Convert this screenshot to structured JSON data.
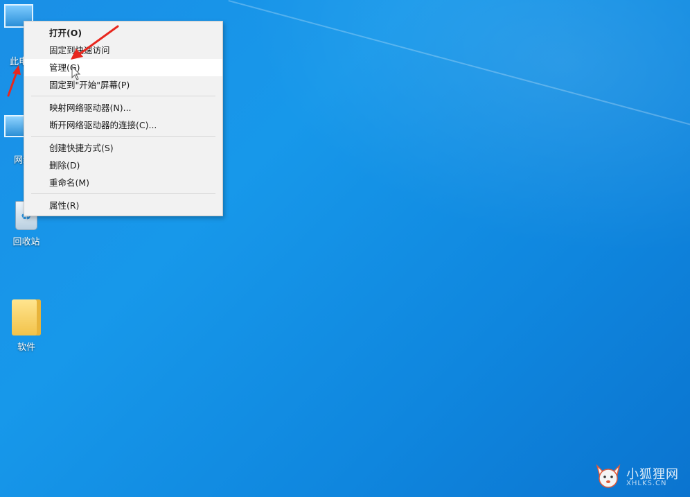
{
  "desktop": {
    "icons": [
      {
        "label": "此电脑"
      },
      {
        "label": "网络"
      },
      {
        "label": "回收站"
      },
      {
        "label": "软件"
      }
    ]
  },
  "context_menu": {
    "items": [
      {
        "label": "打开(O)",
        "bold": true
      },
      {
        "label": "固定到快速访问"
      },
      {
        "label": "管理(G)",
        "highlighted": true
      },
      {
        "label": "固定到\"开始\"屏幕(P)"
      },
      {
        "label": "映射网络驱动器(N)..."
      },
      {
        "label": "断开网络驱动器的连接(C)..."
      },
      {
        "label": "创建快捷方式(S)"
      },
      {
        "label": "删除(D)"
      },
      {
        "label": "重命名(M)"
      },
      {
        "label": "属性(R)"
      }
    ]
  },
  "watermark": {
    "text": "小狐狸网",
    "sub": "XHLKS.CN"
  },
  "colors": {
    "desktop_bg": "#1a8fe6",
    "menu_bg": "#f2f2f2",
    "annotation_arrow": "#e8271e"
  }
}
